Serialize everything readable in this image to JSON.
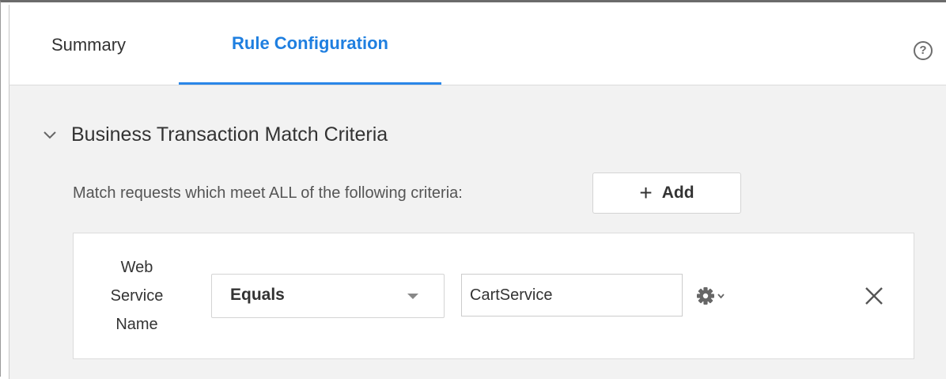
{
  "tabs": [
    {
      "label": "Summary",
      "active": false
    },
    {
      "label": "Rule Configuration",
      "active": true
    }
  ],
  "help": {
    "glyph": "?",
    "icon": "help-circle-icon"
  },
  "section": {
    "title": "Business Transaction Match Criteria",
    "expanded": true,
    "icon": "chevron-down-icon"
  },
  "criteria": {
    "description": "Match requests which meet ALL of the following criteria:",
    "add_label": "Add",
    "add_icon_glyph": "+"
  },
  "rule": {
    "field_line1": "Web",
    "field_line2": "Service",
    "field_line3": "Name",
    "operator": "Equals",
    "value": "CartService",
    "settings_icon": "gear-icon",
    "remove_icon": "close-icon"
  },
  "colors": {
    "accent": "#1f7fe0",
    "content_background": "#f2f2f2"
  }
}
